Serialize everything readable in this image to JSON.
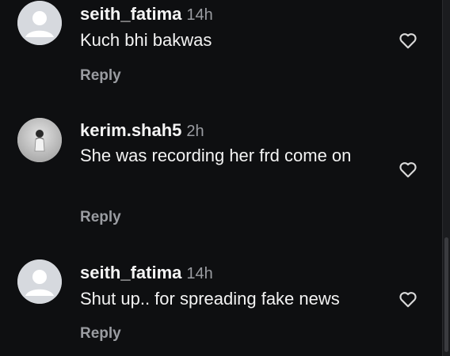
{
  "comments": [
    {
      "username": "seith_fatima",
      "time": "14h",
      "text": "Kuch bhi bakwas",
      "reply_label": "Reply",
      "avatar": "default-avatar-icon"
    },
    {
      "username": "kerim.shah5",
      "time": "2h",
      "text": "She was recording her frd come on",
      "reply_label": "Reply",
      "avatar": "user-photo"
    },
    {
      "username": "seith_fatima",
      "time": "14h",
      "text": "Shut up.. for spreading fake news",
      "reply_label": "Reply",
      "avatar": "default-avatar-icon"
    }
  ],
  "colors": {
    "background": "#0e0f11",
    "text": "#f5f5f5",
    "muted": "#9a9ca1",
    "avatar_default": "#d6d9de"
  }
}
